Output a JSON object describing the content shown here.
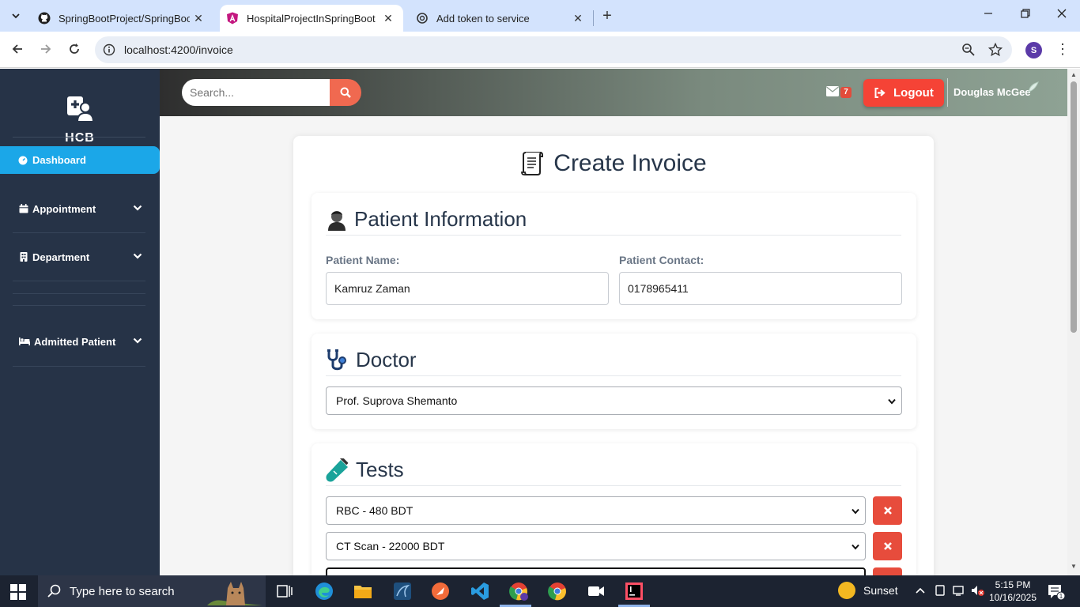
{
  "browser": {
    "tabs": [
      {
        "title": "SpringBootProject/SpringBootP",
        "active": false
      },
      {
        "title": "HospitalProjectInSpringBoot",
        "active": true
      },
      {
        "title": "Add token to service",
        "active": false
      }
    ],
    "url": "localhost:4200/invoice",
    "profile_initial": "S"
  },
  "sidebar": {
    "brand": "HCB",
    "active_item": "Dashboard",
    "items": [
      {
        "label": "Appointment",
        "icon": "calendar-icon"
      },
      {
        "label": "Department",
        "icon": "building-icon"
      },
      {
        "label": "Admitted Patient",
        "icon": "bed-icon"
      }
    ]
  },
  "topbar": {
    "search_placeholder": "Search...",
    "mail_count": "7",
    "logout_label": "Logout",
    "user_name": "Douglas McGee"
  },
  "page": {
    "title": "Create Invoice",
    "patient": {
      "heading": "Patient Information",
      "name_label": "Patient Name:",
      "name_value": "Kamruz Zaman",
      "contact_label": "Patient Contact:",
      "contact_value": "0178965411"
    },
    "doctor": {
      "heading": "Doctor",
      "selected": "Prof. Suprova Shemanto"
    },
    "tests": {
      "heading": "Tests",
      "rows": [
        {
          "selected": "RBC - 480 BDT"
        },
        {
          "selected": "CT Scan - 22000 BDT"
        },
        {
          "selected": ""
        }
      ]
    }
  },
  "taskbar": {
    "search_placeholder": "Type here to search",
    "weather": "Sunset",
    "time": "5:15 PM",
    "date": "10/16/2025",
    "notification_count": "1"
  },
  "colors": {
    "sidebar_bg": "#263347",
    "active_nav": "#1ba7e8",
    "logout": "#f54336",
    "search_button": "#f06950",
    "delete_button": "#e74c3c"
  }
}
